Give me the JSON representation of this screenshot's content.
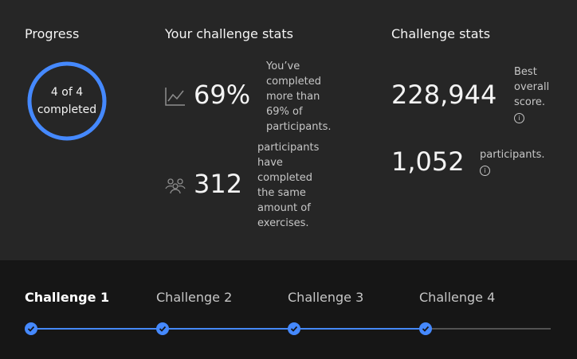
{
  "progress": {
    "title": "Progress",
    "line1": "4 of 4",
    "line2": "completed",
    "completed": 4,
    "total": 4,
    "ring_color": "#4589ff"
  },
  "your_stats": {
    "title": "Your challenge stats",
    "percent": {
      "icon": "trend-chart-icon",
      "value": "69%",
      "description": "You’ve completed more than 69% of participants."
    },
    "participants": {
      "icon": "group-icon",
      "value": "312",
      "description": "participants have completed the same amount of exercises."
    }
  },
  "challenge_stats": {
    "title": "Challenge stats",
    "best": {
      "value": "228,944",
      "description": "Best overall score.",
      "icon": "info-icon"
    },
    "count": {
      "value": "1,052",
      "description": "participants.",
      "icon": "info-icon"
    }
  },
  "stepper": {
    "steps": [
      {
        "label": "Challenge 1",
        "complete": true,
        "active": true
      },
      {
        "label": "Challenge 2",
        "complete": true,
        "active": false
      },
      {
        "label": "Challenge 3",
        "complete": true,
        "active": false
      },
      {
        "label": "Challenge 4",
        "complete": true,
        "active": false
      }
    ],
    "completed_color": "#4589ff",
    "incomplete_color": "#525252",
    "check_icon": "checkmark-icon"
  }
}
